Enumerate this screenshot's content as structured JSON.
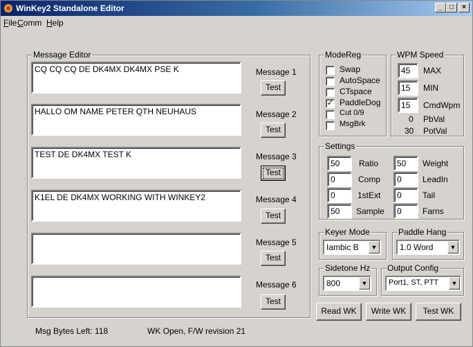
{
  "window": {
    "title": "WinKey2 Standalone Editor"
  },
  "title_buttons": {
    "minimize": "_",
    "maximize": "□",
    "close": "×"
  },
  "menu": [
    {
      "first": "F",
      "rest": "ile"
    },
    {
      "first": "C",
      "rest": "omm"
    },
    {
      "first": "H",
      "rest": "elp"
    }
  ],
  "message_editor": {
    "legend": "Message Editor",
    "test_label": "Test",
    "messages": [
      {
        "label": "Message 1",
        "text": "CQ CQ CQ DE DK4MX DK4MX PSE K"
      },
      {
        "label": "Message 2",
        "text": "HALLO OM NAME PETER QTH NEUHAUS"
      },
      {
        "label": "Message 3",
        "text": "TEST DE DK4MX TEST K"
      },
      {
        "label": "Message 4",
        "text": "K1EL DE DK4MX WORKING WITH WINKEY2"
      },
      {
        "label": "Message 5",
        "text": ""
      },
      {
        "label": "Message 6",
        "text": ""
      }
    ]
  },
  "modereg": {
    "legend": "ModeReg",
    "items": [
      {
        "label": "Swap",
        "checked": false,
        "mark": ""
      },
      {
        "label": "AutoSpace",
        "checked": false,
        "mark": ""
      },
      {
        "label": "CTspace",
        "checked": false,
        "mark": ""
      },
      {
        "label": "PaddleDog",
        "checked": true,
        "mark": "✓"
      },
      {
        "label": "Cut 0/9",
        "checked": false,
        "mark": ""
      },
      {
        "label": "MsgBrk",
        "checked": false,
        "mark": ""
      }
    ]
  },
  "wpm": {
    "legend": "WPM Speed",
    "max": {
      "value": "45",
      "label": "MAX"
    },
    "min": {
      "value": "15",
      "label": "MIN"
    },
    "cmd": {
      "value": "15",
      "label": "CmdWpm"
    },
    "pb": {
      "value": "0",
      "label": "PbVal"
    },
    "pot": {
      "value": "30",
      "label": "PotVal"
    }
  },
  "settings": {
    "legend": "Settings",
    "left": [
      {
        "value": "50",
        "label": "Ratio"
      },
      {
        "value": "0",
        "label": "Comp"
      },
      {
        "value": "0",
        "label": "1stExt"
      },
      {
        "value": "50",
        "label": "Sample"
      }
    ],
    "right": [
      {
        "value": "50",
        "label": "Weight"
      },
      {
        "value": "0",
        "label": "LeadIn"
      },
      {
        "value": "0",
        "label": "Tail"
      },
      {
        "value": "0",
        "label": "Farns"
      }
    ]
  },
  "keyer_mode": {
    "legend": "Keyer Mode",
    "value": "Iambic B"
  },
  "paddle_hang": {
    "legend": "Paddle Hang",
    "value": "1.0 Word"
  },
  "sidetone": {
    "legend": "Sidetone Hz",
    "value": "800"
  },
  "output_config": {
    "legend": "Output Config",
    "value": "Port1, ST, PTT"
  },
  "buttons": {
    "read": "Read WK",
    "write": "Write WK",
    "test": "Test WK"
  },
  "status": {
    "bytes_left": "Msg Bytes Left: 118",
    "wk_status": "WK Open, F/W revision 21"
  }
}
